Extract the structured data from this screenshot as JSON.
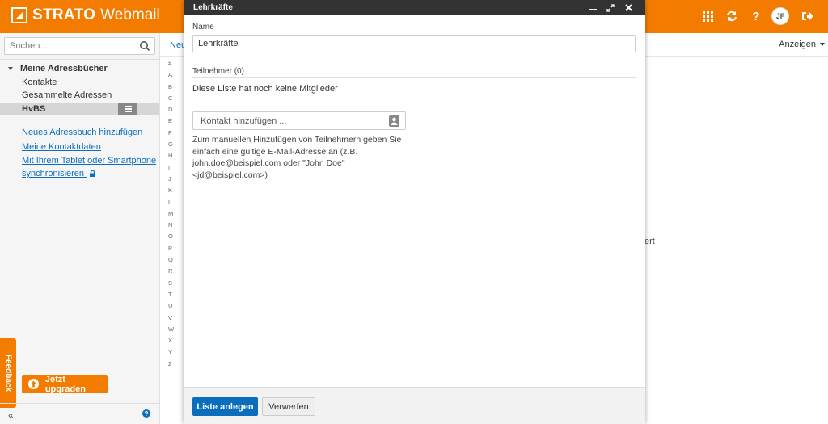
{
  "app": {
    "brand_bold": "STRATO",
    "brand_light": "Webmail",
    "avatar_initials": "JF",
    "accent_color": "#f37c00",
    "top_icons": [
      "grid-icon",
      "refresh-icon",
      "help-icon",
      "avatar",
      "logout-icon"
    ]
  },
  "sidebar": {
    "search_placeholder": "Suchen...",
    "tree_heading": "Meine Adressbücher",
    "items": [
      "Kontakte",
      "Gesammelte Adressen",
      "HvBS"
    ],
    "links": [
      "Neues Adressbuch hinzufügen",
      "Meine Kontaktdaten",
      "Mit Ihrem Tablet oder Smartphone",
      "synchronisieren"
    ],
    "upgrade_label": "Jetzt upgraden",
    "feedback_label": "Feedback",
    "collapse_glyph": "«"
  },
  "main": {
    "new_label": "Neu",
    "view_label": "Anzeigen",
    "alphabet": [
      "#",
      "A",
      "B",
      "C",
      "D",
      "E",
      "F",
      "G",
      "H",
      "I",
      "J",
      "K",
      "L",
      "M",
      "N",
      "O",
      "P",
      "Q",
      "R",
      "S",
      "T",
      "U",
      "V",
      "W",
      "X",
      "Y",
      "Z"
    ],
    "background_text": "ert"
  },
  "modal": {
    "title": "Lehrkräfte",
    "name_label": "Name",
    "name_value": "Lehrkräfte",
    "members_label": "Teilnehmer (0)",
    "empty_text": "Diese Liste hat noch keine Mitglieder",
    "contact_placeholder": "Kontakt hinzufügen ...",
    "help_text": "Zum manuellen Hinzufügen von Teilnehmern geben Sie einfach eine gültige E-Mail-Adresse an (z.B. john.doe@beispiel.com oder \"John Doe\" <jd@beispiel.com>)",
    "create_button": "Liste anlegen",
    "discard_button": "Verwerfen"
  }
}
